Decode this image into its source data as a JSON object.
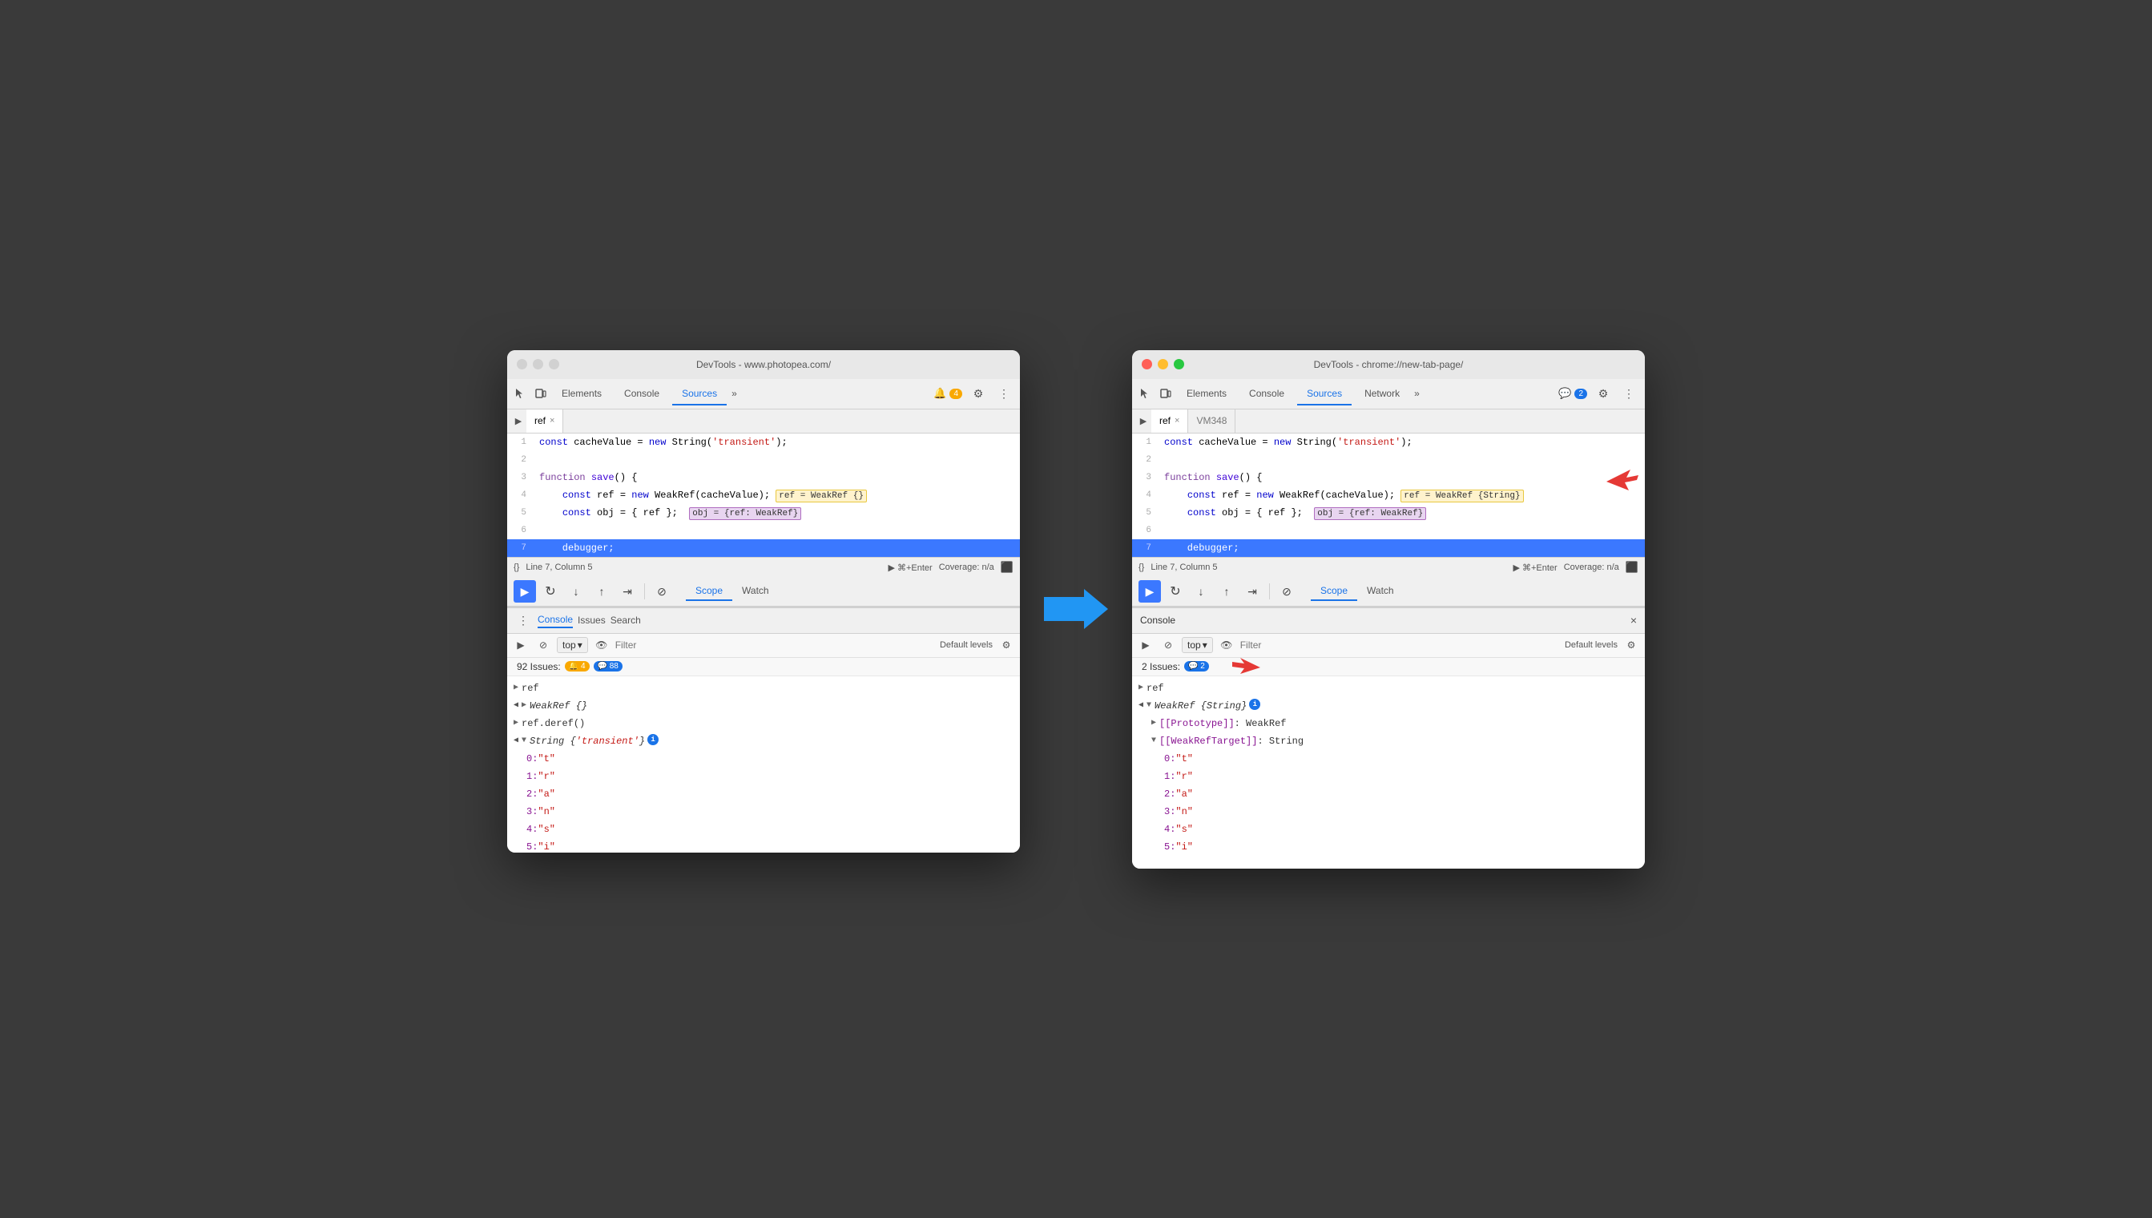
{
  "left_window": {
    "title": "DevTools - www.photopea.com/",
    "tabs": [
      "Elements",
      "Console",
      "Sources",
      "»"
    ],
    "active_tab": "Sources",
    "badge": "4",
    "file_tabs": [
      "ref"
    ],
    "code_lines": [
      {
        "num": 1,
        "content": "const cacheValue = new String('transient');",
        "highlighted": false
      },
      {
        "num": 2,
        "content": "",
        "highlighted": false
      },
      {
        "num": 3,
        "content": "function save() {",
        "highlighted": false
      },
      {
        "num": 4,
        "content": "    const ref = new WeakRef(cacheValue);",
        "highlighted": false,
        "tooltip": "ref = WeakRef {}"
      },
      {
        "num": 5,
        "content": "    const obj = { ref };",
        "highlighted": false,
        "tooltip": "obj = {ref: WeakRef}"
      },
      {
        "num": 6,
        "content": "",
        "highlighted": false
      },
      {
        "num": 7,
        "content": "    debugger;",
        "highlighted": true
      }
    ],
    "status": "Line 7, Column 5",
    "coverage": "Coverage: n/a",
    "debug_tabs": [
      "Scope",
      "Watch"
    ],
    "active_debug_tab": "Scope",
    "console_tabs": [
      "Console",
      "Issues",
      "Search"
    ],
    "active_console_tab": "Console",
    "filter_placeholder": "Filter",
    "filter_levels": "Default levels",
    "top_label": "top",
    "issues_count": "92 Issues:",
    "issues_yellow": "4",
    "issues_blue": "88",
    "console_items": [
      {
        "type": "ref",
        "text": "ref"
      },
      {
        "type": "weakref",
        "text": "▶ WeakRef {}"
      },
      {
        "type": "deref",
        "text": "ref.deref()"
      },
      {
        "type": "string",
        "text": "▼ String {'transient'}"
      },
      {
        "indent": true,
        "text": "0: \"t\""
      },
      {
        "indent": true,
        "text": "1: \"r\""
      },
      {
        "indent": true,
        "text": "2: \"a\""
      },
      {
        "indent": true,
        "text": "3: \"n\""
      },
      {
        "indent": true,
        "text": "4: \"s\""
      },
      {
        "indent": true,
        "text": "5: \"i\""
      }
    ]
  },
  "right_window": {
    "title": "DevTools - chrome://new-tab-page/",
    "tabs": [
      "Elements",
      "Console",
      "Sources",
      "Network",
      "»"
    ],
    "active_tab": "Sources",
    "badge": "2",
    "file_tabs": [
      "ref",
      "VM348"
    ],
    "code_lines": [
      {
        "num": 1,
        "content": "const cacheValue = new String('transient');",
        "highlighted": false
      },
      {
        "num": 2,
        "content": "",
        "highlighted": false
      },
      {
        "num": 3,
        "content": "function save() {",
        "highlighted": false
      },
      {
        "num": 4,
        "content": "    const ref = new WeakRef(cacheValue);",
        "highlighted": false,
        "tooltip": "ref = WeakRef {String}"
      },
      {
        "num": 5,
        "content": "    const obj = { ref };",
        "highlighted": false,
        "tooltip2": "obj = {ref: WeakRef}"
      },
      {
        "num": 6,
        "content": "",
        "highlighted": false
      },
      {
        "num": 7,
        "content": "    debugger;",
        "highlighted": true
      }
    ],
    "status": "Line 7, Column 5",
    "coverage": "Coverage: n/a",
    "debug_tabs": [
      "Scope",
      "Watch"
    ],
    "active_debug_tab": "Scope",
    "top_label": "top",
    "filter_placeholder": "Filter",
    "filter_levels": "Default levels",
    "issues_count": "2 Issues:",
    "issues_blue": "2",
    "console_title": "Console",
    "console_items": [
      {
        "type": "ref",
        "text": "ref"
      },
      {
        "type": "weakref-expanded",
        "text": "▼ WeakRef {String}"
      },
      {
        "indent": true,
        "text": "▶ [[Prototype]]: WeakRef"
      },
      {
        "indent": true,
        "text": "▼ [[WeakRefTarget]]: String"
      },
      {
        "indent2": true,
        "text": "0: \"t\""
      },
      {
        "indent2": true,
        "text": "1: \"r\""
      },
      {
        "indent2": true,
        "text": "2: \"a\""
      },
      {
        "indent2": true,
        "text": "3: \"n\""
      },
      {
        "indent2": true,
        "text": "4: \"s\""
      },
      {
        "indent2": true,
        "text": "5: \"i\""
      }
    ]
  },
  "icons": {
    "close": "×",
    "minimize": "−",
    "maximize": "+",
    "chevron_down": "▾",
    "run": "▶",
    "settings": "⚙",
    "more": "⋮",
    "eye": "👁",
    "resume": "▶",
    "step_over": "↷",
    "step_into": "↓",
    "step_out": "↑",
    "deactivate": "⊘",
    "breakpoints": "⊡"
  }
}
